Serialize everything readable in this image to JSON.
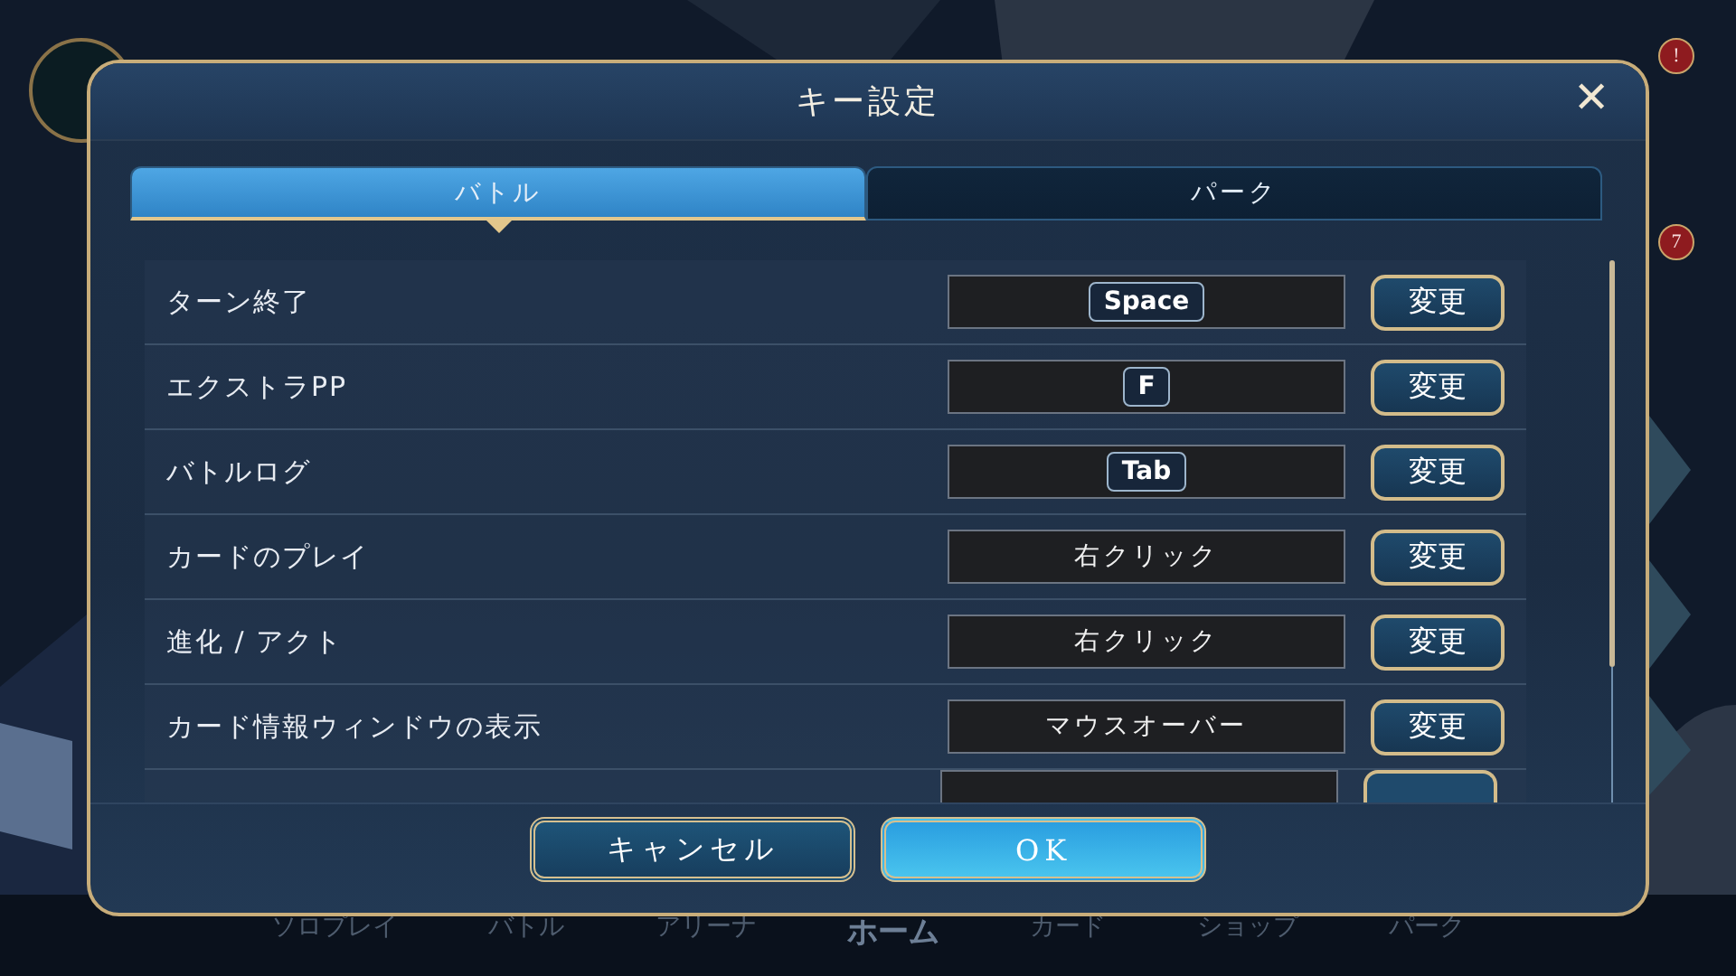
{
  "dialog": {
    "title": "キー設定",
    "close": "✕"
  },
  "tabs": [
    {
      "label": "バトル",
      "selected": true
    },
    {
      "label": "パーク",
      "selected": false
    }
  ],
  "bindings": [
    {
      "action": "ターン終了",
      "kind": "key",
      "value": "Space",
      "button": "変更"
    },
    {
      "action": "エクストラPP",
      "kind": "key",
      "value": "F",
      "button": "変更"
    },
    {
      "action": "バトルログ",
      "kind": "key",
      "value": "Tab",
      "button": "変更"
    },
    {
      "action": "カードのプレイ",
      "kind": "text",
      "value": "右クリック",
      "button": "変更"
    },
    {
      "action": "進化 / アクト",
      "kind": "text",
      "value": "右クリック",
      "button": "変更"
    },
    {
      "action": "カード情報ウィンドウの表示",
      "kind": "text",
      "value": "マウスオーバー",
      "button": "変更"
    }
  ],
  "footer_buttons": [
    {
      "label": "キャンセル",
      "kind": "secondary"
    },
    {
      "label": "OK",
      "kind": "primary"
    }
  ],
  "background": {
    "kind": "picture",
    "badges": [
      "!",
      "7"
    ],
    "nav": [
      "ソロプレイ",
      "バトル",
      "アリーナ",
      "ホーム",
      "カード",
      "ショップ",
      "パーク"
    ]
  }
}
